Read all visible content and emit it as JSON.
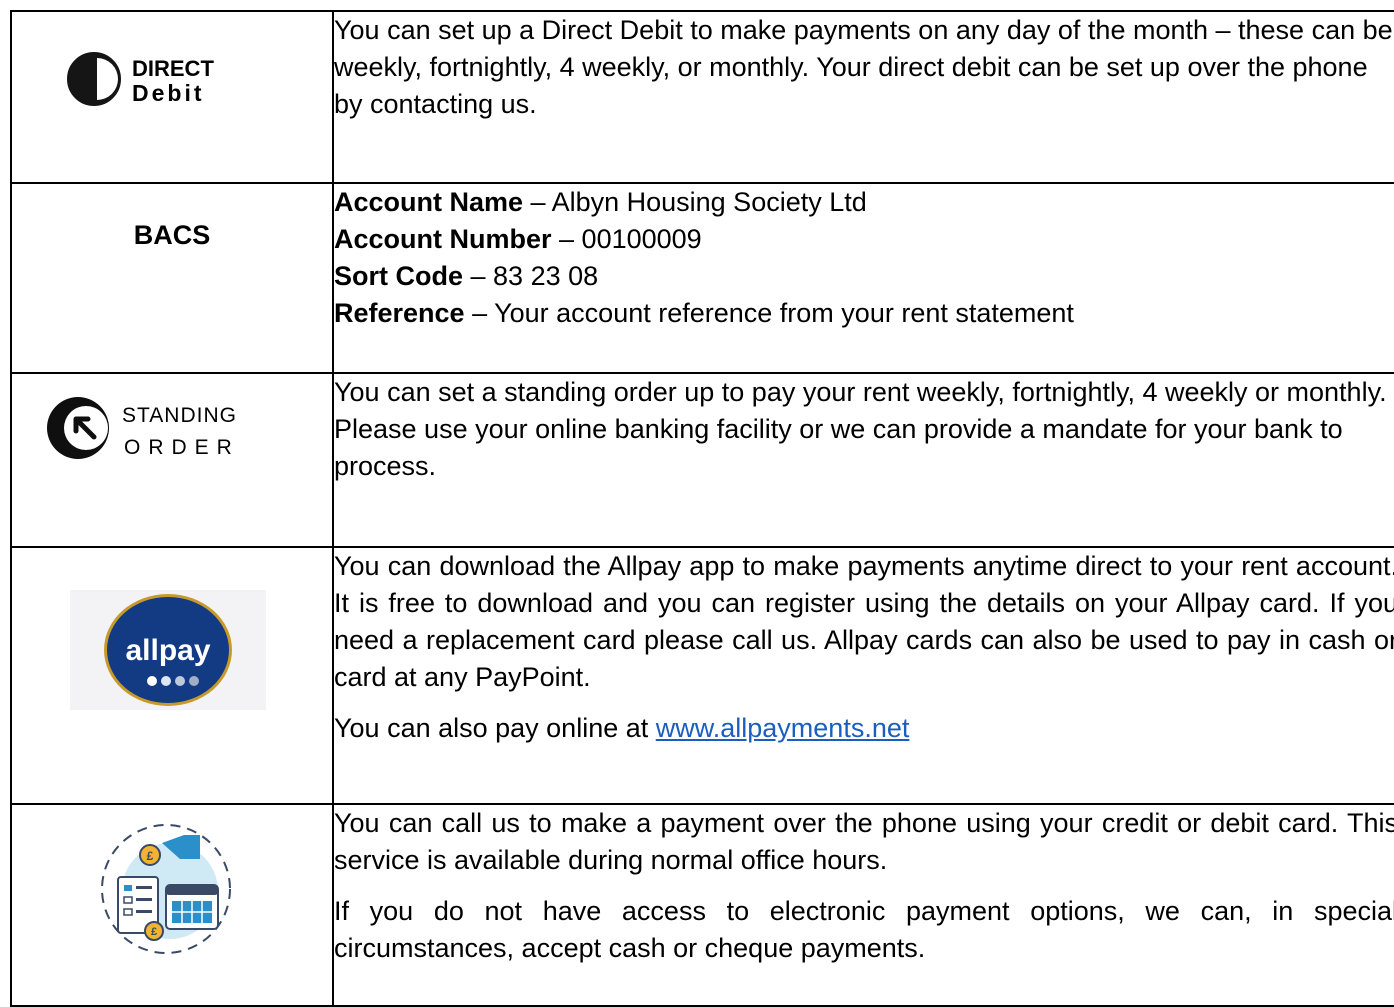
{
  "rows": [
    {
      "logo": {
        "icon": "direct-debit-icon",
        "line1": "DIRECT",
        "line2": "Debit"
      },
      "text": "You can set up a Direct Debit to make payments on any day of the month – these can be weekly, fortnightly, 4 weekly, or monthly. Your direct debit can be set up over the phone by contacting us."
    },
    {
      "label": "BACS",
      "details": [
        {
          "key": "Account Name",
          "value": " – Albyn Housing Society Ltd"
        },
        {
          "key": "Account Number",
          "value": " – 00100009"
        },
        {
          "key": "Sort Code",
          "value": " – 83 23 08"
        },
        {
          "key": "Reference",
          "value": " – Your account reference from your rent statement"
        }
      ]
    },
    {
      "logo": {
        "icon": "standing-order-icon",
        "line1": "STANDING",
        "line2": "ORDER"
      },
      "text": "You can set a standing order up to pay your rent weekly, fortnightly, 4 weekly or monthly. Please use your online banking facility or we can provide a mandate for your bank to process."
    },
    {
      "logo": {
        "icon": "allpay-icon",
        "line1": "allpay"
      },
      "text": "You can download the Allpay app to make payments anytime direct to your rent account.  It is free to download and you can register using the details on your Allpay card.  If you need a replacement card please call us.  Allpay cards can also be used to pay in cash or card at any PayPoint.",
      "online_prefix": "You can also pay online at ",
      "online_link": "www.allpayments.net"
    },
    {
      "logo": {
        "icon": "card-payment-icon"
      },
      "text": "You can call us to make a payment over the phone using your credit or debit card.  This service is available during normal office hours.",
      "text2": "If you do not have access to electronic payment options, we can, in special circumstances, accept cash or cheque payments."
    }
  ],
  "colors": {
    "link": "#1a5fbf",
    "allpay_blue": "#123b84",
    "allpay_gold": "#c89a2a",
    "card_teal": "#2b8fc9"
  }
}
